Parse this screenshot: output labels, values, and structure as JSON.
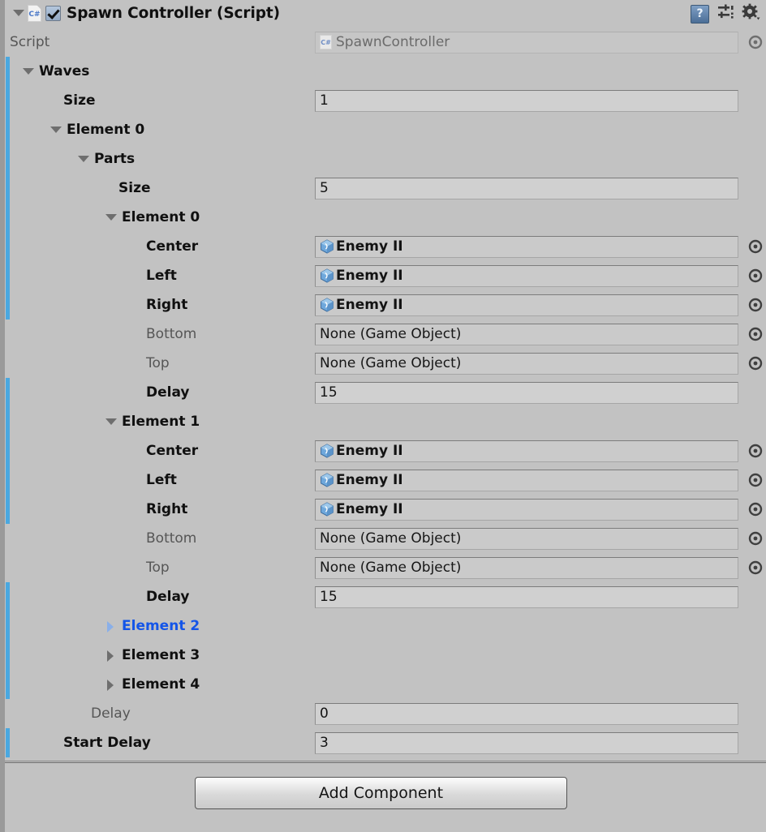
{
  "component": {
    "title": "Spawn Controller (Script)",
    "enabled": true,
    "script_icon": "C#",
    "help_icon": "?",
    "preset_icon": "preset-icon",
    "gear_icon": "gear-icon"
  },
  "script_row": {
    "label": "Script",
    "value": "SpawnController",
    "icon": "C#"
  },
  "rows": [
    {
      "label": "Waves",
      "indent": 0,
      "type": "foldout",
      "open": true,
      "bold": true,
      "override": true
    },
    {
      "label": "Size",
      "indent": 1,
      "type": "number",
      "value": "1",
      "bold": true,
      "override": true
    },
    {
      "label": "Element 0",
      "indent": 1,
      "type": "foldout",
      "open": true,
      "bold": true,
      "override": true
    },
    {
      "label": "Parts",
      "indent": 2,
      "type": "foldout",
      "open": true,
      "bold": true,
      "override": true
    },
    {
      "label": "Size",
      "indent": 3,
      "type": "number",
      "value": "5",
      "bold": true,
      "override": true
    },
    {
      "label": "Element 0",
      "indent": 3,
      "type": "foldout",
      "open": true,
      "bold": true,
      "override": true
    },
    {
      "label": "Center",
      "indent": 4,
      "type": "object",
      "value": "Enemy II",
      "bold": true,
      "override": true
    },
    {
      "label": "Left",
      "indent": 4,
      "type": "object",
      "value": "Enemy II",
      "bold": true,
      "override": true
    },
    {
      "label": "Right",
      "indent": 4,
      "type": "object",
      "value": "Enemy II",
      "bold": true,
      "override": true
    },
    {
      "label": "Bottom",
      "indent": 4,
      "type": "object",
      "value": "None (Game Object)",
      "bold": false,
      "override": false,
      "empty": true
    },
    {
      "label": "Top",
      "indent": 4,
      "type": "object",
      "value": "None (Game Object)",
      "bold": false,
      "override": false,
      "empty": true
    },
    {
      "label": "Delay",
      "indent": 4,
      "type": "number",
      "value": "15",
      "bold": true,
      "override": true
    },
    {
      "label": "Element 1",
      "indent": 3,
      "type": "foldout",
      "open": true,
      "bold": true,
      "override": true
    },
    {
      "label": "Center",
      "indent": 4,
      "type": "object",
      "value": "Enemy II",
      "bold": true,
      "override": true
    },
    {
      "label": "Left",
      "indent": 4,
      "type": "object",
      "value": "Enemy II",
      "bold": true,
      "override": true
    },
    {
      "label": "Right",
      "indent": 4,
      "type": "object",
      "value": "Enemy II",
      "bold": true,
      "override": true
    },
    {
      "label": "Bottom",
      "indent": 4,
      "type": "object",
      "value": "None (Game Object)",
      "bold": false,
      "override": false,
      "empty": true
    },
    {
      "label": "Top",
      "indent": 4,
      "type": "object",
      "value": "None (Game Object)",
      "bold": false,
      "override": false,
      "empty": true
    },
    {
      "label": "Delay",
      "indent": 4,
      "type": "number",
      "value": "15",
      "bold": true,
      "override": true
    },
    {
      "label": "Element 2",
      "indent": 3,
      "type": "foldout",
      "open": false,
      "bold": true,
      "override": true,
      "selected": true
    },
    {
      "label": "Element 3",
      "indent": 3,
      "type": "foldout",
      "open": false,
      "bold": true,
      "override": true
    },
    {
      "label": "Element 4",
      "indent": 3,
      "type": "foldout",
      "open": false,
      "bold": true,
      "override": true
    },
    {
      "label": "Delay",
      "indent": 2,
      "type": "number",
      "value": "0",
      "bold": false,
      "override": false
    },
    {
      "label": "Start Delay",
      "indent": 1,
      "type": "number",
      "value": "3",
      "bold": true,
      "override": true
    }
  ],
  "footer": {
    "add_component_label": "Add Component"
  },
  "colors": {
    "background": "#c2c2c2",
    "override_blue": "#4aa8e0",
    "selected_blue": "#1455e8",
    "field_bg": "#d0d0d0"
  }
}
